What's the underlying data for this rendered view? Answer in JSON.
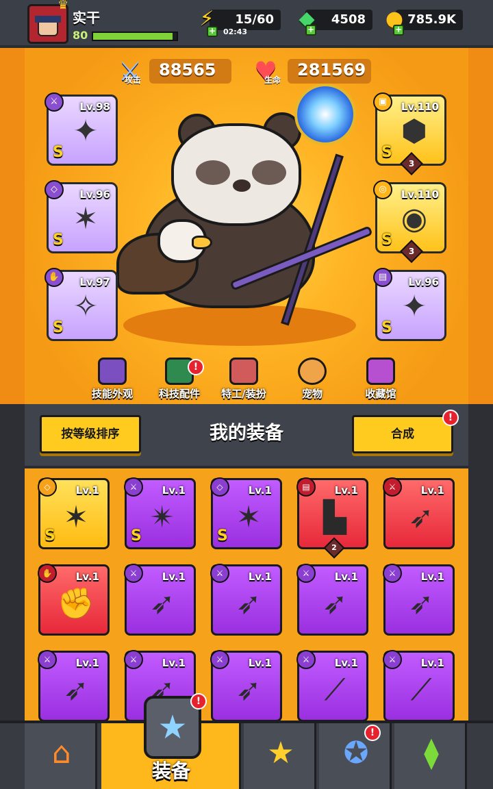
{
  "player": {
    "name": "实干",
    "level": "80",
    "xp_progress": 0.95
  },
  "resources": {
    "energy": "15/60",
    "energy_timer": "02:43",
    "gems": "4508",
    "gold": "785.9K"
  },
  "stats": {
    "attack_label": "攻击",
    "attack": "88565",
    "hp_label": "生命",
    "hp": "281569"
  },
  "equipped": [
    {
      "level": "Lv.98",
      "rank": "S",
      "rarity": "purple"
    },
    {
      "level": "Lv.96",
      "rank": "S",
      "rarity": "purple"
    },
    {
      "level": "Lv.97",
      "rank": "S",
      "rarity": "purple"
    },
    {
      "level": "Lv.110",
      "rank": "S",
      "rarity": "gold",
      "count": "3"
    },
    {
      "level": "Lv.110",
      "rank": "S",
      "rarity": "gold",
      "count": "3"
    },
    {
      "level": "Lv.96",
      "rank": "S",
      "rarity": "purple"
    }
  ],
  "categories": [
    {
      "label": "技能外观"
    },
    {
      "label": "科技配件",
      "alert": "!"
    },
    {
      "label": "特工/装扮"
    },
    {
      "label": "宠物"
    },
    {
      "label": "收藏馆"
    }
  ],
  "panel": {
    "sort_label": "按等级排序",
    "title": "我的装备",
    "merge_label": "合成",
    "merge_alert": "!"
  },
  "inventory": [
    {
      "level": "Lv.1",
      "rank": "S",
      "rarity": "gold"
    },
    {
      "level": "Lv.1",
      "rank": "S",
      "rarity": "purple"
    },
    {
      "level": "Lv.1",
      "rank": "S",
      "rarity": "purple"
    },
    {
      "level": "Lv.1",
      "rank": "",
      "rarity": "red",
      "count": "2"
    },
    {
      "level": "Lv.1",
      "rank": "",
      "rarity": "red"
    },
    {
      "level": "Lv.1",
      "rank": "",
      "rarity": "red"
    },
    {
      "level": "Lv.1",
      "rank": "",
      "rarity": "purple"
    },
    {
      "level": "Lv.1",
      "rank": "",
      "rarity": "purple"
    },
    {
      "level": "Lv.1",
      "rank": "",
      "rarity": "purple"
    },
    {
      "level": "Lv.1",
      "rank": "",
      "rarity": "purple"
    },
    {
      "level": "Lv.1",
      "rank": "",
      "rarity": "purple"
    },
    {
      "level": "Lv.1",
      "rank": "",
      "rarity": "purple"
    },
    {
      "level": "Lv.1",
      "rank": "",
      "rarity": "purple"
    },
    {
      "level": "Lv.1",
      "rank": "",
      "rarity": "purple"
    },
    {
      "level": "Lv.1",
      "rank": "",
      "rarity": "purple"
    }
  ],
  "nav": {
    "equip_label": "装备",
    "equip_alert": "!",
    "orb_alert": "!"
  },
  "icons": {
    "energy": "lightning-bolt-icon",
    "gems": "gem-icon",
    "gold": "coin-icon",
    "attack": "sword-icon",
    "hp": "heart-icon"
  }
}
